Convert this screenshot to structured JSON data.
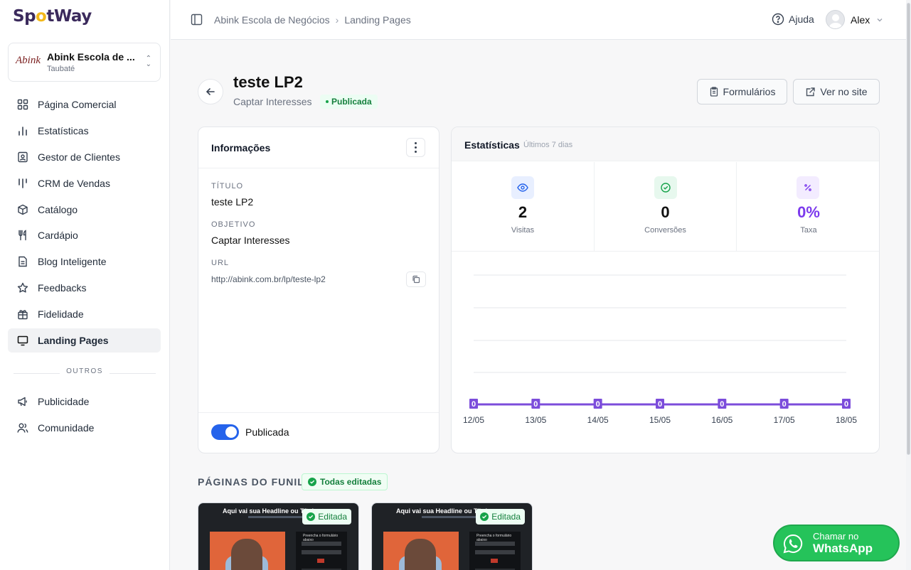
{
  "brand": {
    "logo_pre": "Sp",
    "logo_o": "o",
    "logo_post": "tWay"
  },
  "org": {
    "logo_text": "Abink",
    "name": "Abink Escola de ...",
    "city": "Taubaté"
  },
  "sidebar": {
    "items": [
      {
        "label": "Página Comercial",
        "icon": "grid-icon"
      },
      {
        "label": "Estatísticas",
        "icon": "bar-chart-icon"
      },
      {
        "label": "Gestor de Clientes",
        "icon": "contact-card-icon"
      },
      {
        "label": "CRM de Vendas",
        "icon": "kanban-icon"
      },
      {
        "label": "Catálogo",
        "icon": "package-icon"
      },
      {
        "label": "Cardápio",
        "icon": "utensils-icon"
      },
      {
        "label": "Blog Inteligente",
        "icon": "document-icon"
      },
      {
        "label": "Feedbacks",
        "icon": "star-icon"
      },
      {
        "label": "Fidelidade",
        "icon": "gift-icon"
      },
      {
        "label": "Landing Pages",
        "icon": "monitor-icon",
        "active": true
      }
    ],
    "section_label": "OUTROS",
    "others": [
      {
        "label": "Publicidade",
        "icon": "megaphone-icon"
      },
      {
        "label": "Comunidade",
        "icon": "users-icon"
      }
    ]
  },
  "topbar": {
    "breadcrumb": [
      "Abink Escola de Negócios",
      "Landing Pages"
    ],
    "help_label": "Ajuda",
    "user_name": "Alex"
  },
  "page": {
    "title": "teste LP2",
    "subtitle": "Captar Interesses",
    "status": "Publicada",
    "buttons": {
      "forms": "Formulários",
      "site": "Ver no site"
    }
  },
  "info": {
    "title": "Informações",
    "fields": [
      {
        "label": "TÍTULO",
        "value": "teste LP2"
      },
      {
        "label": "OBJETIVO",
        "value": "Captar Interesses"
      },
      {
        "label": "URL",
        "value": "http://abink.com.br/lp/teste-lp2"
      }
    ],
    "toggle_label": "Publicada",
    "toggle_on": true
  },
  "stats": {
    "title": "Estatísticas",
    "period": "Últimos 7 dias",
    "kpis": [
      {
        "value": "2",
        "label": "Visitas",
        "icon": "eye-icon",
        "bg": "#e8efff",
        "color": "#2563eb"
      },
      {
        "value": "0",
        "label": "Conversões",
        "icon": "check-circle-icon",
        "bg": "#e7f8ee",
        "color": "#16a34a"
      },
      {
        "value": "0%",
        "label": "Taxa",
        "icon": "percent-icon",
        "bg": "#f3ecff",
        "color": "#7c3aed"
      }
    ]
  },
  "chart_data": {
    "type": "line",
    "categories": [
      "12/05",
      "13/05",
      "14/05",
      "15/05",
      "16/05",
      "17/05",
      "18/05"
    ],
    "series": [
      {
        "values": [
          0,
          0,
          0,
          0,
          0,
          0,
          0
        ],
        "color": "#7c4ddb"
      }
    ],
    "data_labels": [
      "0",
      "0",
      "0",
      "0",
      "0",
      "0",
      "0"
    ],
    "grid": true
  },
  "funnel": {
    "title": "PÁGINAS DO FUNIL",
    "badge": "Todas editadas",
    "pages": [
      {
        "headline": "Aqui vai sua Headline ou Título",
        "form_title": "Preencha o formulário abaixo",
        "status": "Editada"
      },
      {
        "headline": "Aqui vai sua Headline ou Título",
        "form_title": "Preencha o formulário abaixo",
        "status": "Editada"
      }
    ]
  },
  "whatsapp": {
    "line1": "Chamar no",
    "line2": "WhatsApp"
  }
}
